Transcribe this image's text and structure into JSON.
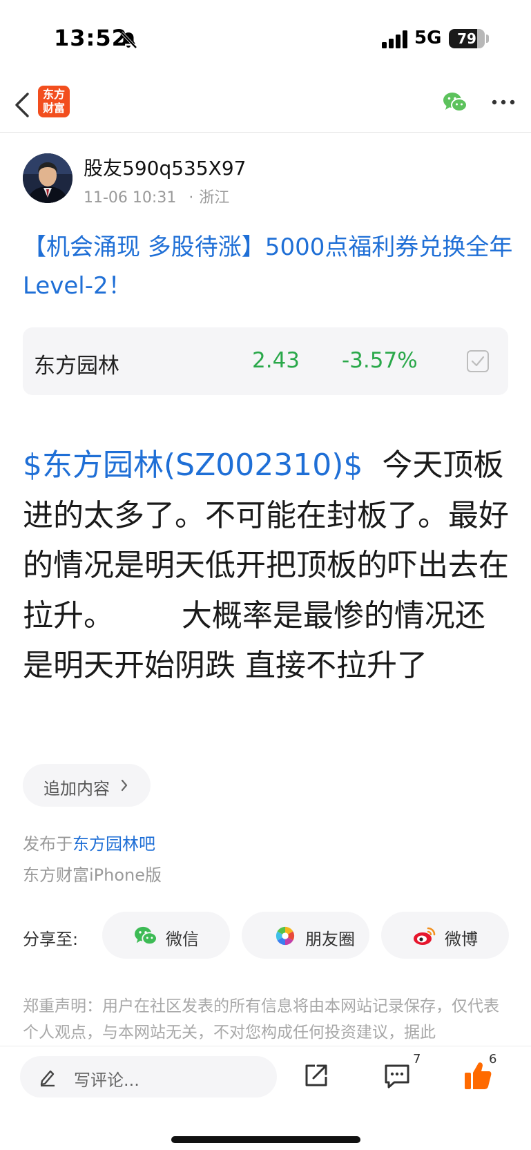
{
  "status_bar": {
    "time": "13:52",
    "network": "5G",
    "battery": "79",
    "battery_level": 0.79
  },
  "nav": {
    "logo_line1": "东方",
    "logo_line2": "财富",
    "icons": [
      "back-icon",
      "wechat-icon",
      "more-icon"
    ]
  },
  "author": {
    "name": "股友590q535X97",
    "date": "11-06 10:31",
    "dot": "·",
    "location": "浙江"
  },
  "post": {
    "title": "【机会涌现 多股待涨】5000点福利券兑换全年Level-2！",
    "stock": {
      "name": "东方园林",
      "price": "2.43",
      "change": "-3.57%"
    },
    "body_tag": "$东方园林(SZ002310)$",
    "body_text": "  今天顶板进的太多了。不可能在封板了。最好的情况是明天低开把顶板的吓出去在拉升。       大概率是最惨的情况还是明天开始阴跌 直接不拉升了",
    "append_label": "追加内容",
    "published_prefix": "发布于",
    "published_forum": "东方园林吧",
    "client": "东方财富iPhone版"
  },
  "share": {
    "label": "分享至:",
    "options": [
      {
        "label": "微信",
        "icon": "wechat-icon"
      },
      {
        "label": "朋友圈",
        "icon": "moments-icon"
      },
      {
        "label": "微博",
        "icon": "weibo-icon"
      }
    ]
  },
  "disclaimer": "郑重声明：用户在社区发表的所有信息将由本网站记录保存，仅代表个人观点，与本网站无关，不对您构成任何投资建议，据此",
  "bottom_bar": {
    "comment_placeholder": "写评论...",
    "comment_count": "7",
    "like_count": "6"
  },
  "colors": {
    "link_blue": "#1f6fd6",
    "down_green": "#2aa84a",
    "brand_orange": "#f24e1e",
    "like_orange": "#ff6a00"
  }
}
